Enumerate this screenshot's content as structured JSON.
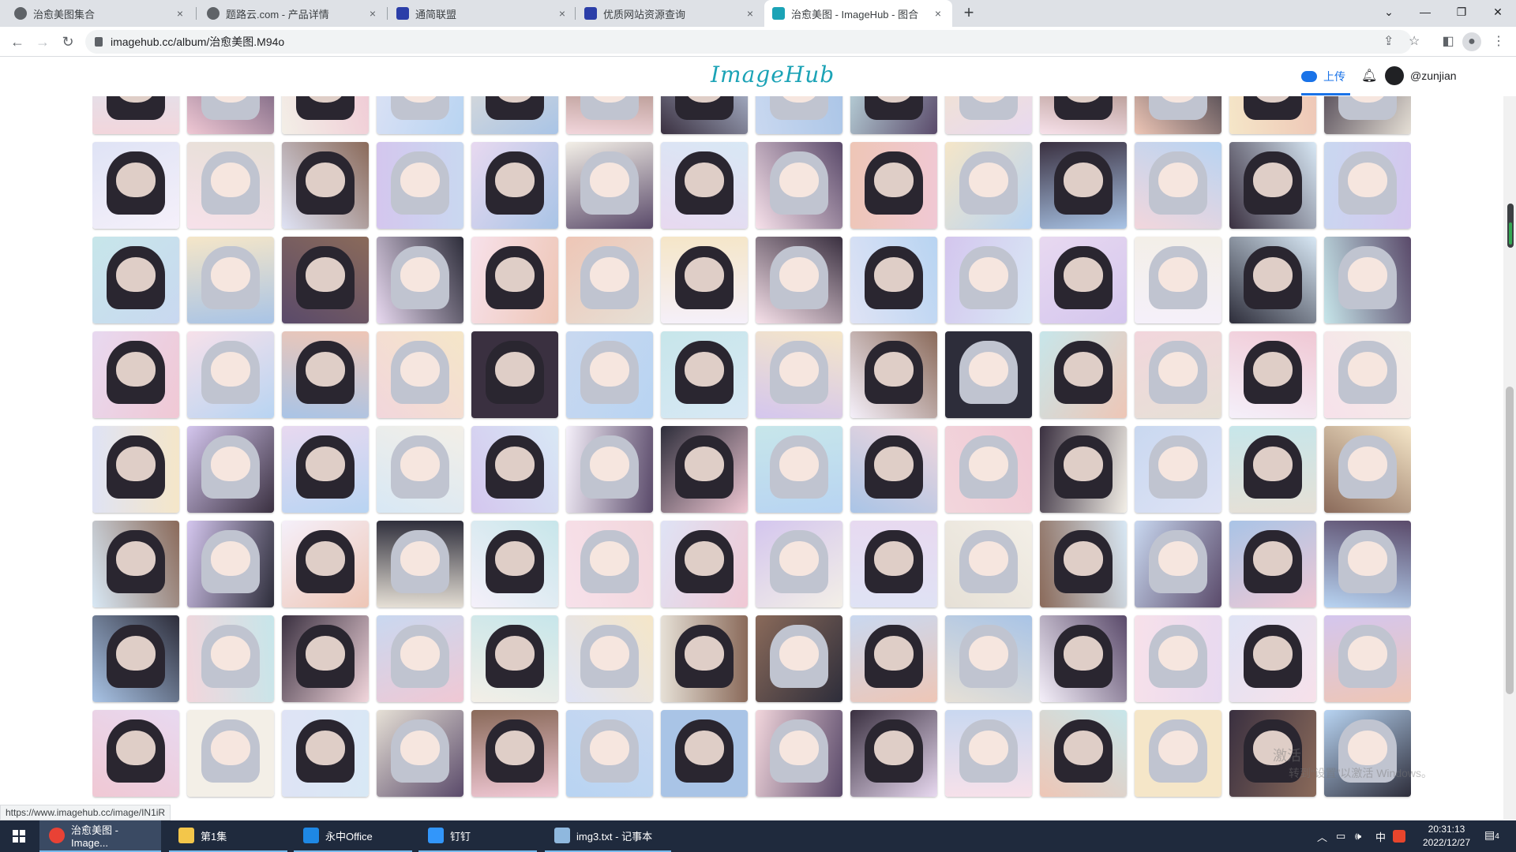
{
  "browser": {
    "tabs": [
      {
        "title": "治愈美图集合",
        "favicon_color": "#5f6368",
        "active": false
      },
      {
        "title": "题路云.com - 产品详情",
        "favicon_color": "#5f6368",
        "active": false
      },
      {
        "title": "通简联盟",
        "favicon_color": "#2b3ea8",
        "active": false
      },
      {
        "title": "优质网站资源查询",
        "favicon_color": "#2b3ea8",
        "active": false
      },
      {
        "title": "治愈美图 - ImageHub - 图合",
        "favicon_color": "#1ba3b6",
        "active": true
      }
    ],
    "tab_close": "×",
    "new_tab": "+",
    "window_controls": {
      "dropdown": "⌄",
      "minimize": "—",
      "maximize": "❐",
      "close": "✕"
    },
    "nav": {
      "back": "←",
      "forward": "→",
      "reload": "↻"
    },
    "url": "imagehub.cc/album/治愈美图.M94o",
    "status_url": "https://www.imagehub.cc/image/IN1iR"
  },
  "site": {
    "logo": "ImageHub",
    "upload_label": "上传",
    "username": "@zunjian",
    "accent": "#1a73e8",
    "logo_color": "#1ba3b6"
  },
  "gallery": {
    "columns": 14,
    "rows": 8,
    "palette": [
      "#f2d6dc",
      "#dfe3f5",
      "#c9d8f0",
      "#e8d9f0",
      "#f5e6c8",
      "#d8e8f5",
      "#2d2d3a",
      "#f0c8d4",
      "#e6e0d6",
      "#a9c4e6",
      "#f7e1ea",
      "#3a3040",
      "#d4c6ee",
      "#c7e6ea",
      "#f3efe7",
      "#8a6a5a",
      "#5a4a6a",
      "#eec6b6",
      "#b8d4f2",
      "#f5f0fa"
    ],
    "hair": [
      "#9a6b4a",
      "#e7e2ea",
      "#2a2630",
      "#f3c2d0",
      "#b8c8ee",
      "#d9b27a",
      "#6a5a8a",
      "#c0c4d0",
      "#8dc8e0",
      "#f0d8a0"
    ]
  },
  "watermark": {
    "line1": "激活",
    "line2": "转到“设置”以激活 Windows。"
  },
  "taskbar": {
    "items": [
      {
        "label": "治愈美图 - Image...",
        "icon_color": "#e94235",
        "state": "active"
      },
      {
        "label": "第1集",
        "icon_color": "#f3c64a",
        "state": "open"
      },
      {
        "label": "永中Office",
        "icon_color": "#1e88e5",
        "state": "open"
      },
      {
        "label": "钉钉",
        "icon_color": "#3296fa",
        "state": "open"
      },
      {
        "label": "img3.txt - 记事本",
        "icon_color": "#8fb8de",
        "state": "open"
      }
    ],
    "tray_chevron": "︿",
    "tray_ime": "中",
    "tray_volume": "🕪",
    "tray_net": "▭",
    "time": "20:31:13",
    "date": "2022/12/27",
    "notifications": "4"
  }
}
